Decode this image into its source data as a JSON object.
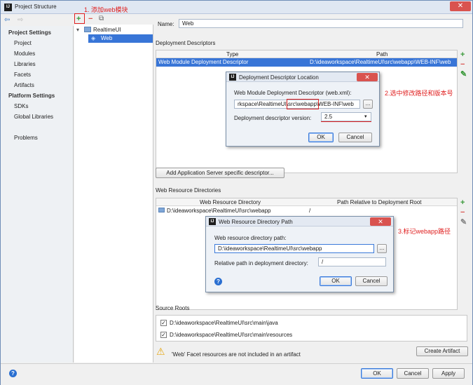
{
  "window": {
    "title": "Project Structure",
    "close": "✕"
  },
  "nav": {
    "back": "⇦",
    "forward": "⇨"
  },
  "sidebar": {
    "project_settings": "Project Settings",
    "items1": [
      "Project",
      "Modules",
      "Libraries",
      "Facets",
      "Artifacts"
    ],
    "platform_settings": "Platform Settings",
    "items2": [
      "SDKs",
      "Global Libraries"
    ],
    "problems": "Problems"
  },
  "tree": {
    "add": "+",
    "remove": "−",
    "copy": "⧉",
    "annotation_add": "1. 添加web模块",
    "module": "RealtimeUI",
    "facet": "Web"
  },
  "facet": {
    "name_label": "Name:",
    "name_value": "Web",
    "descriptors_label": "Deployment Descriptors",
    "descriptors_cols": [
      "Type",
      "Path"
    ],
    "descriptors_row": {
      "type": "Web Module Deployment Descriptor",
      "path": "D:\\ideaworkspace\\RealtimeUI\\src\\webapp\\WEB-INF\\web"
    },
    "add_server_button": "Add Application Server specific descriptor...",
    "resource_dirs_label": "Web Resource Directories",
    "resource_cols": [
      "Web Resource Directory",
      "Path Relative to Deployment Root"
    ],
    "resource_row": {
      "dir": "D:\\ideaworkspace\\RealtimeUI\\src\\webapp",
      "rel": "/"
    },
    "source_roots_label": "Source Roots",
    "source_roots": [
      "D:\\ideaworkspace\\RealtimeUI\\src\\main\\java",
      "D:\\ideaworkspace\\RealtimeUI\\src\\main\\resources"
    ],
    "warning": "'Web' Facet resources are not included in an artifact",
    "create_artifact": "Create Artifact"
  },
  "dialog1": {
    "title": "Deployment Descriptor Location",
    "path_label": "Web Module Deployment Descriptor (web.xml):",
    "path_value": "rkspace\\RealtimeUI\\src\\webapp\\WEB-INF\\web",
    "browse": "...",
    "version_label": "Deployment descriptor version:",
    "version_value": "2.5",
    "ok": "OK",
    "cancel": "Cancel",
    "annotation": "2.选中修改路径和版本号"
  },
  "dialog2": {
    "title": "Web Resource Directory Path",
    "dir_label": "Web resource directory path:",
    "dir_value": "D:\\ideaworkspace\\RealtimeUI\\src\\webapp",
    "browse": "...",
    "rel_label": "Relative path in deployment directory:",
    "rel_value": "/",
    "ok": "OK",
    "cancel": "Cancel",
    "annotation": "3.标记webapp路径"
  },
  "footer": {
    "ok": "OK",
    "cancel": "Cancel",
    "apply": "Apply"
  }
}
